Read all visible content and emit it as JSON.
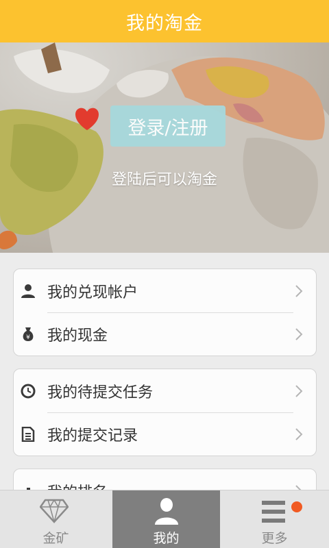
{
  "header": {
    "title": "我的淘金"
  },
  "hero": {
    "login_label": "登录/注册",
    "hint": "登陆后可以淘金"
  },
  "menu": {
    "group1": [
      {
        "label": "我的兑现帐户",
        "icon": "user-icon"
      },
      {
        "label": "我的现金",
        "icon": "money-bag-icon"
      }
    ],
    "group2": [
      {
        "label": "我的待提交任务",
        "icon": "clock-icon"
      },
      {
        "label": "我的提交记录",
        "icon": "document-icon"
      }
    ],
    "group3": [
      {
        "label": "我的排名",
        "icon": "ranking-icon"
      }
    ]
  },
  "tabbar": {
    "tabs": [
      {
        "label": "金矿",
        "icon": "diamond-icon",
        "active": false
      },
      {
        "label": "我的",
        "icon": "person-icon",
        "active": true
      },
      {
        "label": "更多",
        "icon": "menu-lines-icon",
        "active": false,
        "badge": true
      }
    ]
  },
  "colors": {
    "header_bg": "#fcc22f",
    "login_button_bg": "#a7d8dc",
    "active_tab_bg": "#7f7f7f",
    "badge": "#f15a22"
  }
}
